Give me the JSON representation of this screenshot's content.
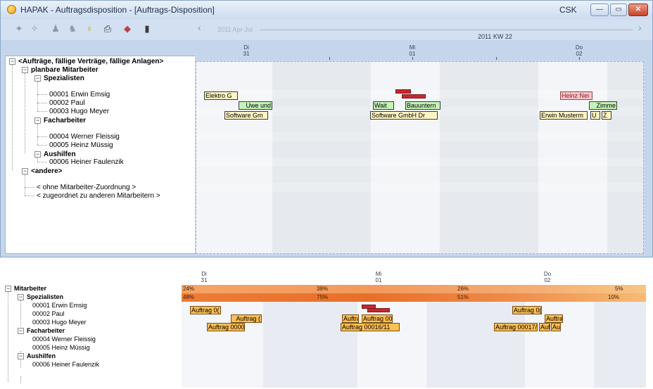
{
  "window": {
    "title": "HAPAK - Auftragsdisposition - [Auftrags-Disposition]",
    "user": "CSK",
    "controls": {
      "minimize": "—",
      "restore": "▭",
      "close": "✕"
    }
  },
  "toolbar": {
    "icons": [
      "puzzle-icon",
      "puzzle-pair-icon",
      "person-icon",
      "person-walk-icon",
      "bulb-icon",
      "printer-icon",
      "book-icon",
      "exit-door-icon"
    ]
  },
  "timeline": {
    "range_label": "2011 Apr-Jul",
    "week_label": "2011 KW 22",
    "days": [
      {
        "name": "Di",
        "num": "31"
      },
      {
        "name": "Mi",
        "num": "01"
      },
      {
        "name": "Do",
        "num": "02"
      }
    ]
  },
  "tree": {
    "root": "<Aufträge, fällige Verträge, fällige Anlagen>",
    "group": "planbare Mitarbeiter",
    "spezialisten": "Spezialisten",
    "e1": "00001 Erwin Emsig",
    "e2": "00002 Paul",
    "e3": "00003 Hugo Meyer",
    "facharbeiter": "Facharbeiter",
    "e4": "00004 Werner Fleissig",
    "e5": "00005 Heinz Müssig",
    "aushilfen": "Aushilfen",
    "e6": "00006 Heiner Faulenzik",
    "andere": "<andere>",
    "ohne": "< ohne Mitarbeiter-Zuordnung >",
    "zugeordnet": "< zugeordnet zu anderen Mitarbeitern >"
  },
  "bars_top": {
    "elektro": "Elektro G",
    "heinz": "Heinz Nei",
    "uwe": "Uwe und",
    "wait": "Wait",
    "bau": "Bauuntern",
    "zimme": "Zimme",
    "sw1": "Software  Gm",
    "sw2": "Software  GmbH  Dr",
    "erwin": "Erwin Musterm",
    "u": "U",
    "z": "Z"
  },
  "bottom": {
    "tree": {
      "mitarbeiter": "Mitarbeiter",
      "spezialisten": "Spezialisten",
      "e1": "00001 Erwin Emsig",
      "e2": "00002 Paul",
      "e3": "00003 Hugo Meyer",
      "facharbeiter": "Facharbeiter",
      "e4": "00004 Werner Fleissig",
      "e5": "00005 Heinz Müssig",
      "aushilfen": "Aushilfen",
      "e6": "00006 Heiner Faulenzik"
    },
    "util_mitarbeiter": [
      "24%",
      "38%",
      "26%",
      "5%"
    ],
    "util_spezialisten": [
      "48%",
      "75%",
      "51%",
      "10%"
    ],
    "bars": {
      "b1": "Auftrag 0(",
      "b2": "Auftrag 0(",
      "b3": "Auftrag (",
      "b4": "Auftra",
      "b5": "Auftrag 00(",
      "b6": "Auftra",
      "b7": "Auftrag 0000",
      "b8": "Auftrag 00016/11",
      "b9": "Auftrag 00017/",
      "b10": "Auf",
      "b11": "Aul"
    }
  },
  "colors": {
    "window_bg": "#c5d6ec",
    "grid_bg": "#e6e9ee",
    "bar_yellow": "#fff5c4",
    "bar_green": "#c5f2b8",
    "bar_pink": "#f7c6cc",
    "bar_orange": "#fbbf55",
    "conflict_red": "#c8282e",
    "util_orange": "#f08c3c"
  }
}
